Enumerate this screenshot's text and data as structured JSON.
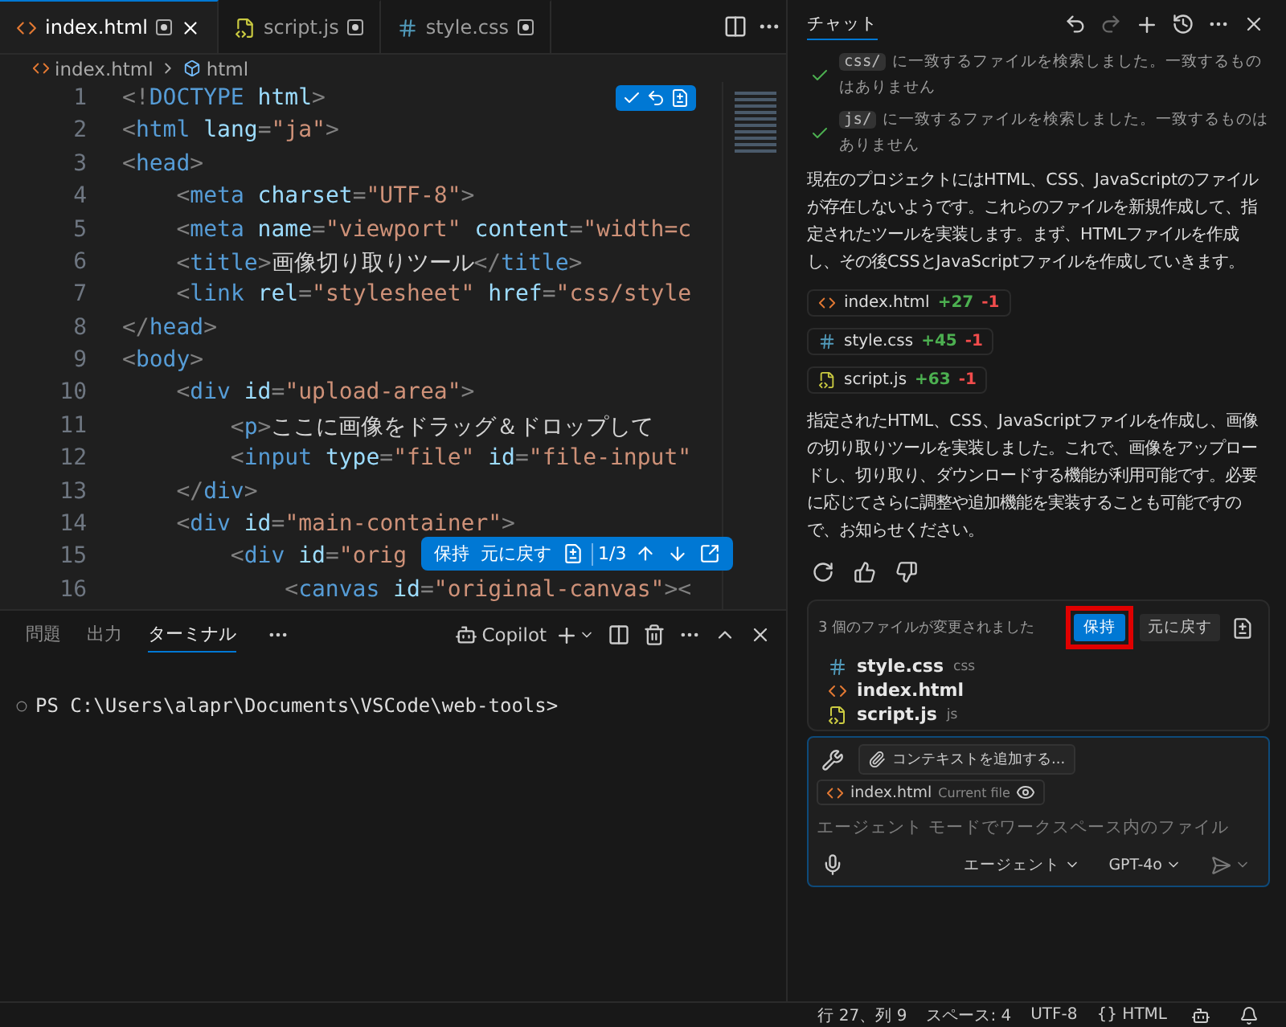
{
  "editor_tabs": [
    {
      "label": "index.html",
      "kind": "html",
      "selected": true,
      "modified": true
    },
    {
      "label": "script.js",
      "kind": "js",
      "selected": false,
      "modified": true
    },
    {
      "label": "style.css",
      "kind": "css",
      "selected": false,
      "modified": true
    }
  ],
  "breadcrumb": [
    "index.html",
    "html"
  ],
  "code_lines": [
    {
      "number": "1",
      "tokens": [
        {
          "kind": "punct",
          "t": "<!"
        },
        {
          "kind": "tag",
          "t": "DOCTYPE"
        },
        {
          "kind": "attr",
          "t": " html"
        },
        {
          "kind": "punct",
          "t": ">"
        }
      ]
    },
    {
      "number": "2",
      "tokens": [
        {
          "kind": "punct",
          "t": "<"
        },
        {
          "kind": "tag",
          "t": "html"
        },
        {
          "kind": "attr",
          "t": " lang"
        },
        {
          "kind": "punct",
          "t": "="
        },
        {
          "kind": "string",
          "t": "\"ja\""
        },
        {
          "kind": "punct",
          "t": ">"
        }
      ]
    },
    {
      "number": "3",
      "tokens": [
        {
          "kind": "punct",
          "t": "<"
        },
        {
          "kind": "tag",
          "t": "head"
        },
        {
          "kind": "punct",
          "t": ">"
        }
      ]
    },
    {
      "number": "4",
      "tokens": [
        {
          "kind": "punct",
          "t": "    <"
        },
        {
          "kind": "tag",
          "t": "meta"
        },
        {
          "kind": "attr",
          "t": " charset"
        },
        {
          "kind": "punct",
          "t": "="
        },
        {
          "kind": "string",
          "t": "\"UTF-8\""
        },
        {
          "kind": "punct",
          "t": ">"
        }
      ]
    },
    {
      "number": "5",
      "tokens": [
        {
          "kind": "punct",
          "t": "    <"
        },
        {
          "kind": "tag",
          "t": "meta"
        },
        {
          "kind": "attr",
          "t": " name"
        },
        {
          "kind": "punct",
          "t": "="
        },
        {
          "kind": "string",
          "t": "\"viewport\""
        },
        {
          "kind": "attr",
          "t": " content"
        },
        {
          "kind": "punct",
          "t": "="
        },
        {
          "kind": "string",
          "t": "\"width=c"
        }
      ]
    },
    {
      "number": "6",
      "tokens": [
        {
          "kind": "punct",
          "t": "    <"
        },
        {
          "kind": "tag",
          "t": "title"
        },
        {
          "kind": "punct",
          "t": ">"
        },
        {
          "kind": "text",
          "t": "画像切り取りツール"
        },
        {
          "kind": "punct",
          "t": "</"
        },
        {
          "kind": "tag",
          "t": "title"
        },
        {
          "kind": "punct",
          "t": ">"
        }
      ]
    },
    {
      "number": "7",
      "tokens": [
        {
          "kind": "punct",
          "t": "    <"
        },
        {
          "kind": "tag",
          "t": "link"
        },
        {
          "kind": "attr",
          "t": " rel"
        },
        {
          "kind": "punct",
          "t": "="
        },
        {
          "kind": "string",
          "t": "\"stylesheet\""
        },
        {
          "kind": "attr",
          "t": " href"
        },
        {
          "kind": "punct",
          "t": "="
        },
        {
          "kind": "string",
          "t": "\"css/style"
        }
      ]
    },
    {
      "number": "8",
      "tokens": [
        {
          "kind": "punct",
          "t": "</"
        },
        {
          "kind": "tag",
          "t": "head"
        },
        {
          "kind": "punct",
          "t": ">"
        }
      ]
    },
    {
      "number": "9",
      "tokens": [
        {
          "kind": "punct",
          "t": "<"
        },
        {
          "kind": "tag",
          "t": "body"
        },
        {
          "kind": "punct",
          "t": ">"
        }
      ]
    },
    {
      "number": "10",
      "tokens": [
        {
          "kind": "punct",
          "t": "    <"
        },
        {
          "kind": "tag",
          "t": "div"
        },
        {
          "kind": "attr",
          "t": " id"
        },
        {
          "kind": "punct",
          "t": "="
        },
        {
          "kind": "string",
          "t": "\"upload-area\""
        },
        {
          "kind": "punct",
          "t": ">"
        }
      ]
    },
    {
      "number": "11",
      "tokens": [
        {
          "kind": "punct",
          "t": "        <"
        },
        {
          "kind": "tag",
          "t": "p"
        },
        {
          "kind": "punct",
          "t": ">"
        },
        {
          "kind": "text",
          "t": "ここに画像をドラッグ＆ドロップして"
        }
      ]
    },
    {
      "number": "12",
      "tokens": [
        {
          "kind": "punct",
          "t": "        <"
        },
        {
          "kind": "tag",
          "t": "input"
        },
        {
          "kind": "attr",
          "t": " type"
        },
        {
          "kind": "punct",
          "t": "="
        },
        {
          "kind": "string",
          "t": "\"file\""
        },
        {
          "kind": "attr",
          "t": " id"
        },
        {
          "kind": "punct",
          "t": "="
        },
        {
          "kind": "string",
          "t": "\"file-input\""
        }
      ]
    },
    {
      "number": "13",
      "tokens": [
        {
          "kind": "punct",
          "t": "    </"
        },
        {
          "kind": "tag",
          "t": "div"
        },
        {
          "kind": "punct",
          "t": ">"
        }
      ]
    },
    {
      "number": "14",
      "tokens": [
        {
          "kind": "punct",
          "t": "    <"
        },
        {
          "kind": "tag",
          "t": "div"
        },
        {
          "kind": "attr",
          "t": " id"
        },
        {
          "kind": "punct",
          "t": "="
        },
        {
          "kind": "string",
          "t": "\"main-container\""
        },
        {
          "kind": "punct",
          "t": ">"
        }
      ]
    },
    {
      "number": "15",
      "tokens": [
        {
          "kind": "punct",
          "t": "        <"
        },
        {
          "kind": "tag",
          "t": "div"
        },
        {
          "kind": "attr",
          "t": " id"
        },
        {
          "kind": "punct",
          "t": "="
        },
        {
          "kind": "string",
          "t": "\"orig"
        }
      ]
    },
    {
      "number": "16",
      "tokens": [
        {
          "kind": "punct",
          "t": "            <"
        },
        {
          "kind": "tag",
          "t": "canvas"
        },
        {
          "kind": "attr",
          "t": " id"
        },
        {
          "kind": "punct",
          "t": "="
        },
        {
          "kind": "string",
          "t": "\"original-canvas\""
        },
        {
          "kind": "punct",
          "t": "><"
        }
      ]
    }
  ],
  "diff_toolbar": {
    "keep": "保持",
    "undo": "元に戻す",
    "counter": "1/3"
  },
  "panel": {
    "tabs": [
      {
        "label": "問題",
        "selected": false
      },
      {
        "label": "出力",
        "selected": false
      },
      {
        "label": "ターミナル",
        "selected": true
      }
    ],
    "terminal_name": "Copilot",
    "terminal_lines": [
      "PS C:\\Users\\alapr\\Documents\\VSCode\\web-tools>"
    ]
  },
  "chat": {
    "title": "チャット",
    "tool_results": [
      {
        "code": "css/",
        "text": "に一致するファイルを検索しました。一致するものはありません"
      },
      {
        "code": "js/",
        "text": "に一致するファイルを検索しました。一致するものはありません"
      }
    ],
    "intro": "現在のプロジェクトにはHTML、CSS、JavaScriptのファイルが存在しないようです。これらのファイルを新規作成して、指定されたツールを実装します。まず、HTMLファイルを作成し、その後CSSとJavaScriptファイルを作成していきます。",
    "file_edits": [
      {
        "name": "index.html",
        "kind": "html",
        "added": "+27",
        "removed": "-1"
      },
      {
        "name": "style.css",
        "kind": "css",
        "added": "+45",
        "removed": "-1"
      },
      {
        "name": "script.js",
        "kind": "js",
        "added": "+63",
        "removed": "-1"
      }
    ],
    "summary": "指定されたHTML、CSS、JavaScriptファイルを作成し、画像の切り取りツールを実装しました。これで、画像をアップロードし、切り取り、ダウンロードする機能が利用可能です。必要に応じてさらに調整や追加機能を実装することも可能ですので、お知らせください。",
    "changes": {
      "title": "3 個のファイルが変更されました",
      "keep": "保持",
      "keep_highlighted": true,
      "undo": "元に戻す",
      "files": [
        {
          "name": "style.css",
          "kind": "css",
          "detail": "css"
        },
        {
          "name": "index.html",
          "kind": "html"
        },
        {
          "name": "script.js",
          "kind": "js",
          "detail": "js"
        }
      ]
    },
    "input": {
      "attach": "コンテキストを追加する...",
      "context_file": "index.html",
      "context_note": "Current file",
      "placeholder": "エージェント モードでワークスペース内のファイル",
      "mode": "エージェント",
      "model": "GPT-4o"
    }
  },
  "status_bar": [
    "行 27、列 9",
    "スペース: 4",
    "UTF-8",
    "{} HTML"
  ]
}
